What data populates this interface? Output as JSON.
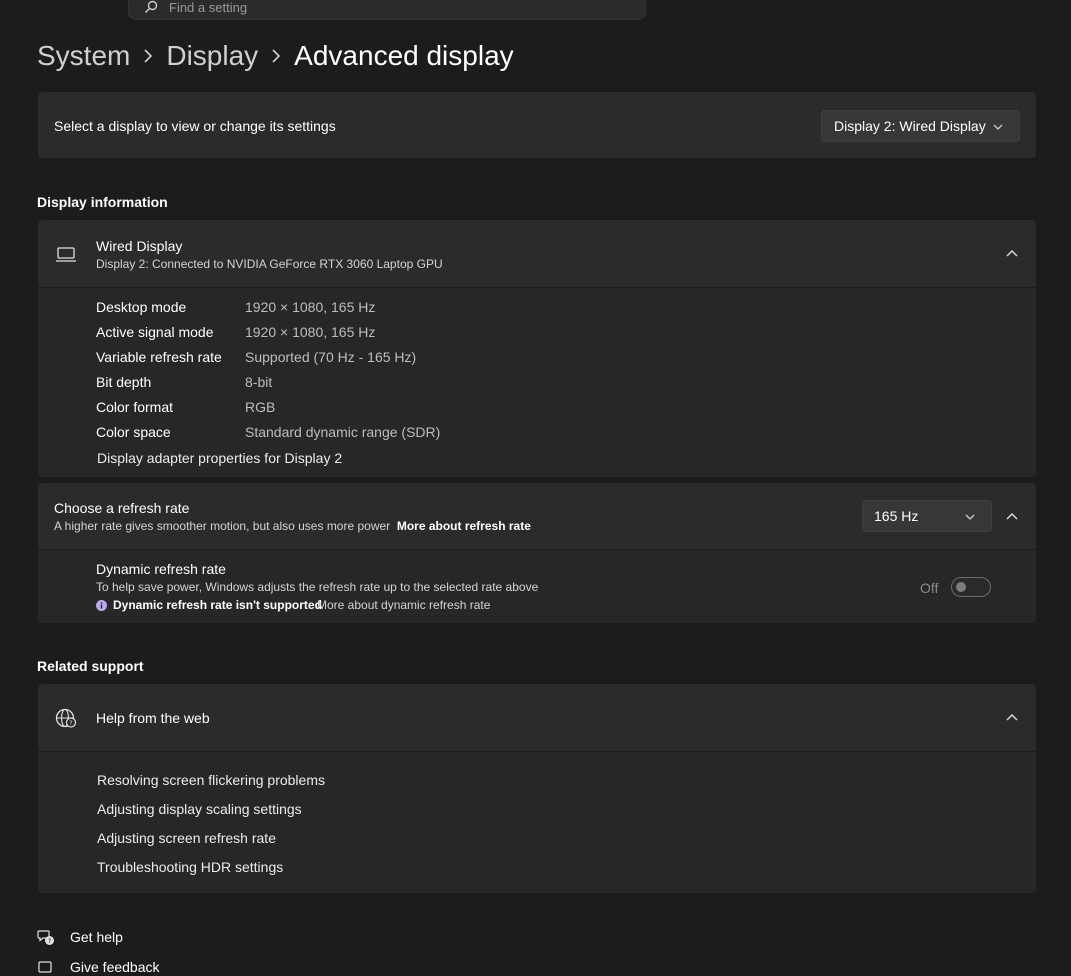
{
  "search": {
    "placeholder": "Find a setting"
  },
  "breadcrumb": {
    "items": [
      "System",
      "Display"
    ],
    "current": "Advanced display"
  },
  "display_select": {
    "label": "Select a display to view or change its settings",
    "value": "Display 2: Wired Display"
  },
  "display_information": {
    "section_title": "Display information",
    "device_name": "Wired Display",
    "device_subtitle": "Display 2: Connected to NVIDIA GeForce RTX 3060 Laptop GPU",
    "rows": [
      {
        "key": "Desktop mode",
        "value": "1920 × 1080, 165 Hz"
      },
      {
        "key": "Active signal mode",
        "value": "1920 × 1080, 165 Hz"
      },
      {
        "key": "Variable refresh rate",
        "value": "Supported (70 Hz - 165 Hz)"
      },
      {
        "key": "Bit depth",
        "value": "8-bit"
      },
      {
        "key": "Color format",
        "value": "RGB"
      },
      {
        "key": "Color space",
        "value": "Standard dynamic range (SDR)"
      }
    ],
    "adapter_link": "Display adapter properties for Display 2"
  },
  "refresh_rate": {
    "title": "Choose a refresh rate",
    "description": "A higher rate gives smoother motion, but also uses more power",
    "more_link": "More about refresh rate",
    "value": "165 Hz",
    "dynamic": {
      "title": "Dynamic refresh rate",
      "description": "To help save power, Windows adjusts the refresh rate up to the selected rate above",
      "warning": "Dynamic refresh rate isn't supported",
      "more_link": "More about dynamic refresh rate",
      "toggle_state": "Off"
    }
  },
  "related_support": {
    "section_title": "Related support",
    "help_title": "Help from the web",
    "links": [
      "Resolving screen flickering problems",
      "Adjusting display scaling settings",
      "Adjusting screen refresh rate",
      "Troubleshooting HDR settings"
    ]
  },
  "footer": {
    "get_help": "Get help",
    "give_feedback": "Give feedback"
  },
  "colors": {
    "background": "#1c1c1c",
    "card": "#2b2b2b",
    "accent_text": "#ffffff"
  }
}
